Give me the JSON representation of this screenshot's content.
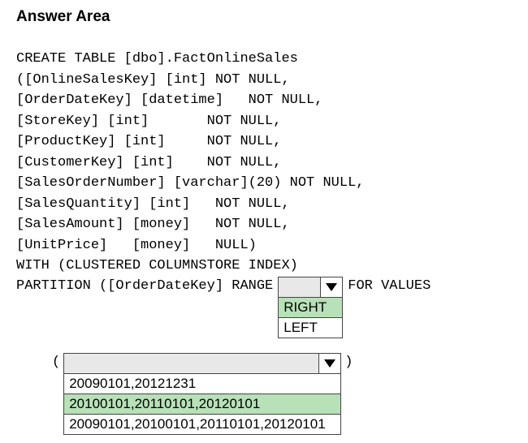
{
  "title": "Answer Area",
  "code": {
    "l1": "CREATE TABLE [dbo].FactOnlineSales",
    "l2": "([OnlineSalesKey] [int] NOT NULL,",
    "l3": "[OrderDateKey] [datetime]   NOT NULL,",
    "l4": "[StoreKey] [int]       NOT NULL,",
    "l5": "[ProductKey] [int]     NOT NULL,",
    "l6": "[CustomerKey] [int]    NOT NULL,",
    "l7": "[SalesOrderNumber] [varchar](20) NOT NULL,",
    "l8": "[SalesQuantity] [int]   NOT NULL,",
    "l9": "[SalesAmount] [money]   NOT NULL,",
    "l10": "[UnitPrice]   [money]   NULL)",
    "l11": "WITH (CLUSTERED COLUMNSTORE INDEX)",
    "l12_a": "PARTITION ([OrderDateKey] RANGE",
    "l12_b": "FOR VALUES"
  },
  "dd1": {
    "value": "",
    "options": [
      "RIGHT",
      "LEFT"
    ],
    "selectedIndex": 0
  },
  "paren_open": "(",
  "paren_close": ")",
  "dd2": {
    "value": "",
    "options": [
      "20090101,20121231",
      "20100101,20110101,20120101",
      "20090101,20100101,20110101,20120101"
    ],
    "selectedIndex": 1
  }
}
